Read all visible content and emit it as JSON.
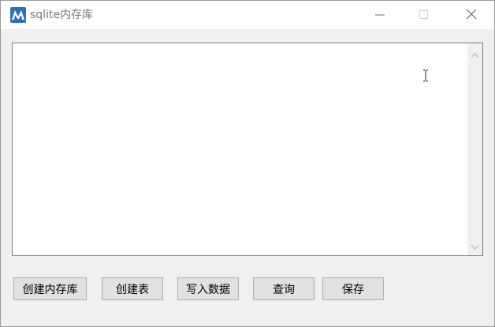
{
  "window": {
    "title": "sqlite内存库",
    "icons": {
      "app": "app-logo-icon",
      "minimize": "minimize-icon",
      "maximize": "maximize-icon",
      "close": "close-icon"
    }
  },
  "editor": {
    "value": "",
    "scrollbar": {
      "up_icon": "scroll-up-arrow-icon",
      "down_icon": "scroll-down-arrow-icon"
    },
    "cursor_icon": "text-cursor-icon"
  },
  "buttons": {
    "create_memdb": "创建内存库",
    "create_table": "创建表",
    "write_data": "写入数据",
    "query": "查询",
    "save": "保存"
  },
  "colors": {
    "app_icon_bg": "#2f6fb7",
    "window_bg": "#f0f0f0",
    "button_bg": "#e1e1e1"
  }
}
